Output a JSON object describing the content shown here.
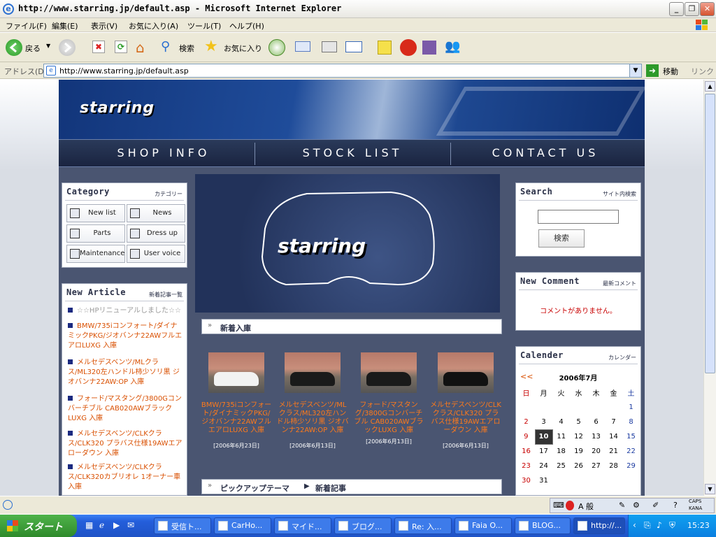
{
  "window": {
    "title": "http://www.starring.jp/default.asp - Microsoft Internet Explorer"
  },
  "menu": [
    "ファイル(F)",
    "編集(E)",
    "表示(V)",
    "お気に入り(A)",
    "ツール(T)",
    "ヘルプ(H)"
  ],
  "toolbar": {
    "back": "戻る",
    "search": "検索",
    "favorites": "お気に入り"
  },
  "address": {
    "label": "アドレス(D)",
    "url": "http://www.starring.jp/default.asp",
    "go": "移動",
    "links": "リンク"
  },
  "site": {
    "logo": "starring",
    "nav": [
      "SHOP INFO",
      "STOCK LIST",
      "CONTACT US"
    ],
    "category": {
      "title": "Category",
      "subtitle": "カテゴリー",
      "items": [
        "New list",
        "News",
        "Parts",
        "Dress up",
        "Maintenance",
        "User voice"
      ]
    },
    "new_article": {
      "title": "New Article",
      "subtitle": "新着記事一覧",
      "items": [
        "☆☆HPリニューアルしました☆☆",
        "BMW/735iコンフォート/ダイナミックPKG/ジオバンナ22AWフルエアロLUXG 入庫",
        "メルセデスベンツ/MLクラス/ML320左ハンドル柿少ソリ黒 ジオバンナ22AW:OP 入庫",
        "フォード/マスタング/3800Gコンバーチブル CAB020AWブラックLUXG 入庫",
        "メルセデスベンツ/CLKクラス/CLK320 プラバス仕様19AWエアローダウン 入庫",
        "メルセデスベンツ/CLKクラス/CLK320カブリオレ 1オーナー車 入庫"
      ]
    },
    "hero_logo": "starring",
    "new_stock": {
      "title": "新着入庫"
    },
    "products": [
      {
        "text": "BMW/735iコンフォート/ダイナミックPKG/ジオバンナ22AWフルエアロLUXG 入庫",
        "date": "[2006年6月23日]"
      },
      {
        "text": "メルセデスベンツ/MLクラス/ML320左ハンドル柿少ソリ黒 ジオバンナ22AW:OP 入庫",
        "date": "[2006年6月13日]"
      },
      {
        "text": "フォード/マスタング/3800Gコンバーチブル CAB020AWブラックLUXG 入庫",
        "date": "[2006年6月13日]"
      },
      {
        "text": "メルセデスベンツ/CLKクラス/CLK320 プラバス仕様19AWエアローダウン 入庫",
        "date": "[2006年6月13日]"
      }
    ],
    "pickup": {
      "title": "ピックアップテーマ",
      "sub": "新着記事"
    },
    "search": {
      "title": "Search",
      "subtitle": "サイト内検索",
      "button": "検索",
      "value": ""
    },
    "new_comment": {
      "title": "New Comment",
      "subtitle": "最新コメント",
      "empty": "コメントがありません。"
    },
    "calendar": {
      "title": "Calender",
      "subtitle": "カレンダー",
      "prev": "<<",
      "month": "2006年7月",
      "weekdays": [
        "日",
        "月",
        "火",
        "水",
        "木",
        "金",
        "土"
      ],
      "weeks": [
        [
          "",
          "",
          "",
          "",
          "",
          "",
          "1"
        ],
        [
          "2",
          "3",
          "4",
          "5",
          "6",
          "7",
          "8"
        ],
        [
          "9",
          "10",
          "11",
          "12",
          "13",
          "14",
          "15"
        ],
        [
          "16",
          "17",
          "18",
          "19",
          "20",
          "21",
          "22"
        ],
        [
          "23",
          "24",
          "25",
          "26",
          "27",
          "28",
          "29"
        ],
        [
          "30",
          "31",
          "",
          "",
          "",
          "",
          ""
        ]
      ],
      "today": "10"
    }
  },
  "statusbar": {
    "ime": "A 般",
    "caps": "CAPS",
    "kana": "KANA"
  },
  "taskbar": {
    "start": "スタート",
    "tasks": [
      "受信ト...",
      "CarHo...",
      "マイド...",
      "ブログ...",
      "Re: 入...",
      "Faia O...",
      "BLOG...",
      "http://..."
    ],
    "clock": "15:23"
  },
  "colors": {
    "accent_orange": "#ff7a1a",
    "link_orange": "#d94f00",
    "nav_bg": "#1a2440",
    "body_bg": "#4a5571"
  }
}
